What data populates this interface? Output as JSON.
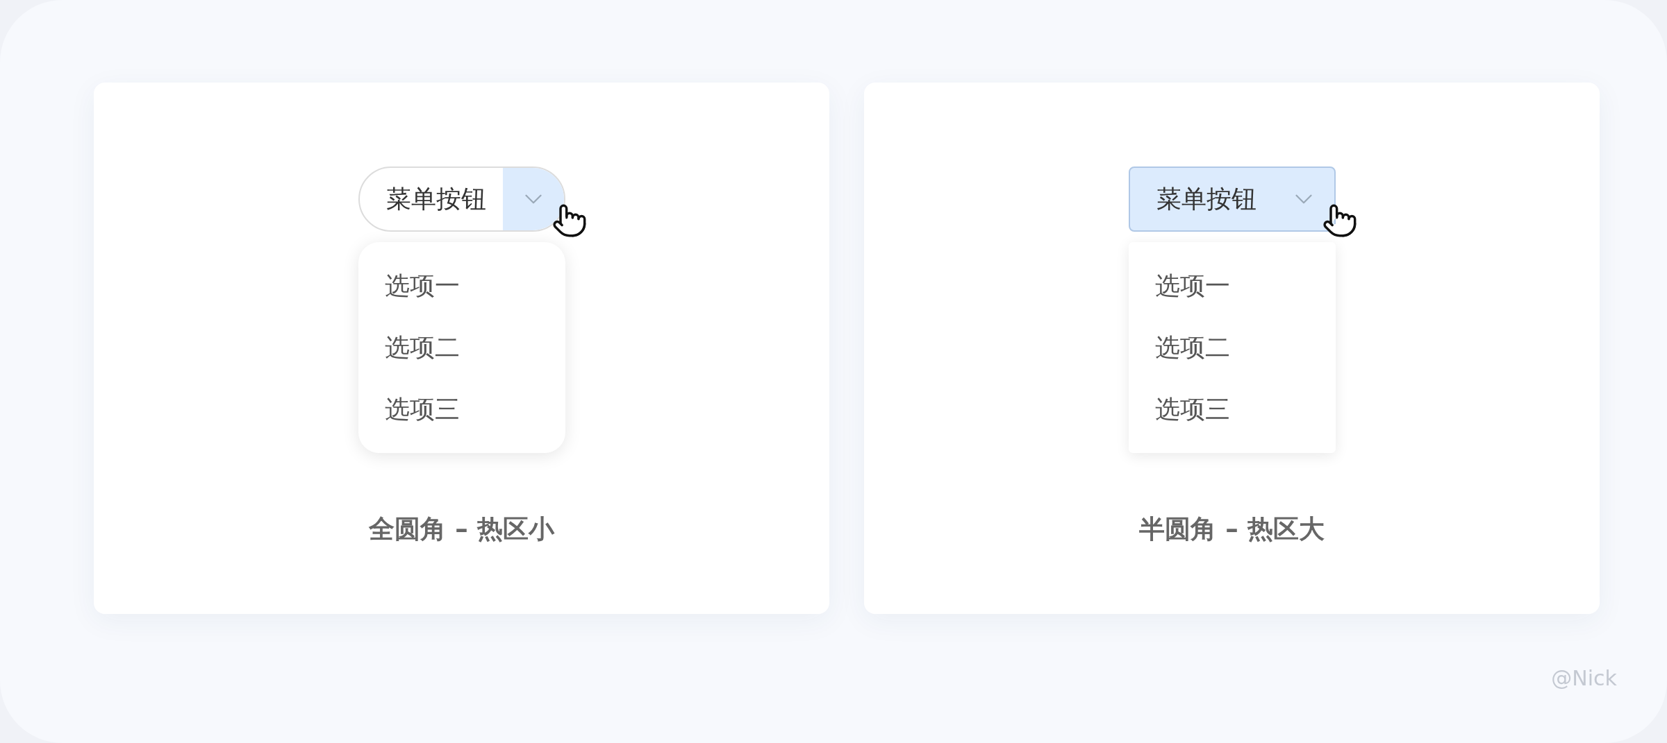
{
  "panels": [
    {
      "kind": "pill",
      "button": {
        "label": "菜单按钮"
      },
      "options": [
        "选项一",
        "选项二",
        "选项三"
      ],
      "caption": "全圆角 – 热区小"
    },
    {
      "kind": "rounded",
      "button": {
        "label": "菜单按钮"
      },
      "options": [
        "选项一",
        "选项二",
        "选项三"
      ],
      "caption": "半圆角 – 热区大"
    }
  ],
  "signature": "@Nick"
}
